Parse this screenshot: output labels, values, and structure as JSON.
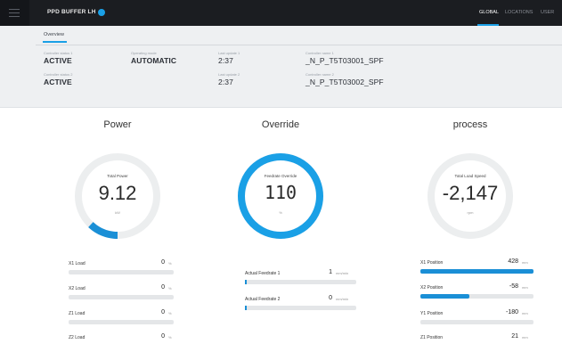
{
  "header": {
    "app_title": "PPD BUFFER LH",
    "tabs": [
      "GLOBAL",
      "LOCATIONS",
      "USER"
    ],
    "active_tab": 0,
    "accent": "#1aa0e6"
  },
  "subtab": {
    "label": "Overview"
  },
  "info": {
    "fields": [
      {
        "label": "Controller status 1",
        "value": "ACTIVE"
      },
      {
        "label": "Controller status 2",
        "value": "ACTIVE"
      },
      {
        "label": "Operating mode",
        "value": "AUTOMATIC"
      },
      {
        "label": "Last update 1",
        "value": "2:37"
      },
      {
        "label": "Last update 2",
        "value": "2:37"
      },
      {
        "label": "Controller name 1",
        "value": "_N_P_T5T03001_SPF"
      },
      {
        "label": "Controller name 2",
        "value": "_N_P_T5T03002_SPF"
      }
    ]
  },
  "gauges": [
    {
      "title": "Power",
      "label": "Total Power",
      "value": "9.12",
      "unit": "kW",
      "fraction": 0.12,
      "color": "#1a8fd6"
    },
    {
      "title": "Override",
      "label": "Feedrate Override",
      "value": "110",
      "unit": "%",
      "fraction": 1.0,
      "color": "#1aa0e6"
    },
    {
      "title": "process",
      "label": "Total Load Speed",
      "value": "-2,147",
      "unit": "rpm",
      "fraction": 0.0,
      "color": "#1a8fd6"
    }
  ],
  "power_bars": [
    {
      "name": "X1 Load",
      "value": "0",
      "unit": "%",
      "fraction": 0.0
    },
    {
      "name": "X2 Load",
      "value": "0",
      "unit": "%",
      "fraction": 0.0
    },
    {
      "name": "Z1 Load",
      "value": "0",
      "unit": "%",
      "fraction": 0.0
    },
    {
      "name": "Z2 Load",
      "value": "0",
      "unit": "%",
      "fraction": 0.0
    }
  ],
  "override_bars": [
    {
      "name": "Actual Feedrate 1",
      "value": "1",
      "unit": "mm/min",
      "fraction": 0.01
    },
    {
      "name": "Actual Feedrate 2",
      "value": "0",
      "unit": "mm/min",
      "fraction": 0.0
    }
  ],
  "process_bars": [
    {
      "name": "X1 Position",
      "value": "428",
      "unit": "mm",
      "fraction": 1.0
    },
    {
      "name": "X2 Position",
      "value": "-58",
      "unit": "mm",
      "fraction": 0.43
    },
    {
      "name": "Y1 Position",
      "value": "-180",
      "unit": "mm",
      "fraction": 0.0
    },
    {
      "name": "Z1 Position",
      "value": "21",
      "unit": "mm",
      "fraction": 0.0
    }
  ]
}
